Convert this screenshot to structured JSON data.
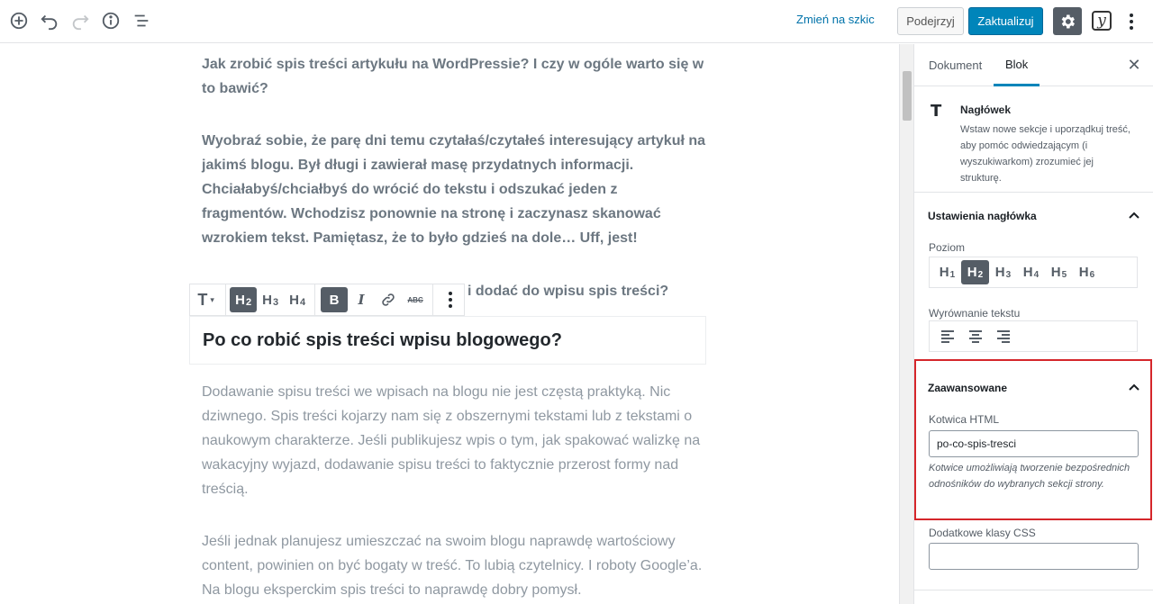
{
  "toolbar": {
    "icons": [
      "add-block-icon",
      "undo-icon",
      "redo-icon",
      "info-icon",
      "outline-icon"
    ],
    "switch_draft": "Zmień na szkic",
    "preview": "Podejrzyj",
    "update": "Zaktualizuj",
    "settings_icon": "gear-icon",
    "yoast_glyph": "y",
    "more_icon": "more-vertical-icon"
  },
  "editor": {
    "paragraphs": [
      "Jak zrobić spis treści artykułu na WordPressie? I czy w ogóle warto się w to bawić?",
      "Wyobraź sobie, że parę dni temu czytałaś/czytałeś interesujący artykuł na jakimś blogu. Był długi i zawierał masę przydatnych informacji. Chciałabyś/chciałbyś do wrócić do tekstu i odszukać jeden z fragmentów.  Wchodzisz ponownie na stronę i zaczynasz skanować wzrokiem tekst. Pamiętasz, że to było gdzieś na dole… Uff, jest!",
      "i dodać do wpisu spis treści?",
      "Dodawanie spisu treści we wpisach na blogu nie jest częstą praktyką. Nic dziwnego. Spis treści kojarzy nam się z obszernymi tekstami lub z tekstami o naukowym charakterze. Jeśli publikujesz wpis o tym, jak spakować walizkę na wakacyjny wyjazd, dodawanie spisu treści to faktycznie przerost formy nad treścią.",
      "Jeśli jednak planujesz umieszczać na swoim blogu naprawdę wartościowy content, powinien on być bogaty w treść. To lubią czytelnicy. I roboty Google’a. Na blogu eksperckim spis treści to naprawdę dobry pomysł."
    ],
    "heading": "Po co robić spis treści wpisu blogowego?",
    "block_toolbar": {
      "type_glyph": "T",
      "levels": [
        {
          "h": "H",
          "n": "2",
          "active": true
        },
        {
          "h": "H",
          "n": "3",
          "active": false
        },
        {
          "h": "H",
          "n": "4",
          "active": false
        }
      ],
      "bold": "B",
      "italic": "I",
      "strike": "ABC"
    }
  },
  "sidebar": {
    "tab_document": "Dokument",
    "tab_block": "Blok",
    "close_glyph": "✕",
    "block_card": {
      "icon_glyph": "T",
      "title": "Nagłówek",
      "description": "Wstaw nowe sekcje i uporządkuj treść, aby pomóc odwiedzającym (i wyszukiwarkom) zrozumieć jej strukturę."
    },
    "heading_settings": {
      "title": "Ustawienia nagłówka",
      "level_label": "Poziom",
      "levels": [
        {
          "h": "H",
          "n": "1",
          "active": false
        },
        {
          "h": "H",
          "n": "2",
          "active": true
        },
        {
          "h": "H",
          "n": "3",
          "active": false
        },
        {
          "h": "H",
          "n": "4",
          "active": false
        },
        {
          "h": "H",
          "n": "5",
          "active": false
        },
        {
          "h": "H",
          "n": "6",
          "active": false
        }
      ],
      "align_label": "Wyrównanie tekstu"
    },
    "advanced": {
      "title": "Zaawansowane",
      "anchor_label": "Kotwica HTML",
      "anchor_value": "po-co-spis-tresci",
      "anchor_help": "Kotwice umożliwiają tworzenie bezpośrednich odnośników do wybranych sekcji strony.",
      "css_label": "Dodatkowe klasy CSS",
      "css_value": ""
    }
  },
  "colors": {
    "accent": "#0085ba",
    "highlight_frame": "#d5262b",
    "active_button": "#555d66"
  }
}
